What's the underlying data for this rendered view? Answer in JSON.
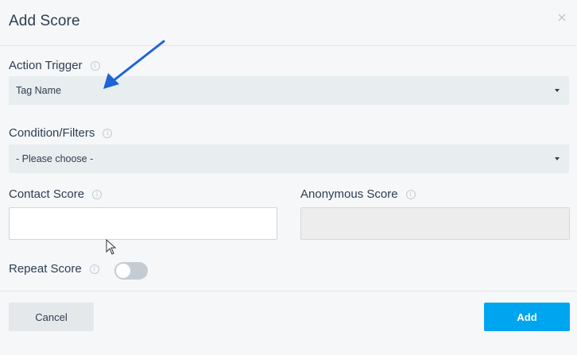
{
  "dialog": {
    "title": "Add Score",
    "close_icon": "close-icon"
  },
  "action_trigger": {
    "label": "Action Trigger",
    "value": "Tag Name"
  },
  "condition_filters": {
    "label": "Condition/Filters",
    "value": "- Please choose -"
  },
  "contact_score": {
    "label": "Contact Score",
    "value": ""
  },
  "anonymous_score": {
    "label": "Anonymous Score",
    "value": ""
  },
  "repeat_score": {
    "label": "Repeat Score",
    "enabled": false
  },
  "footer": {
    "cancel_label": "Cancel",
    "add_label": "Add"
  },
  "colors": {
    "accent": "#00a5f0",
    "annotation_arrow": "#1e63d6"
  }
}
